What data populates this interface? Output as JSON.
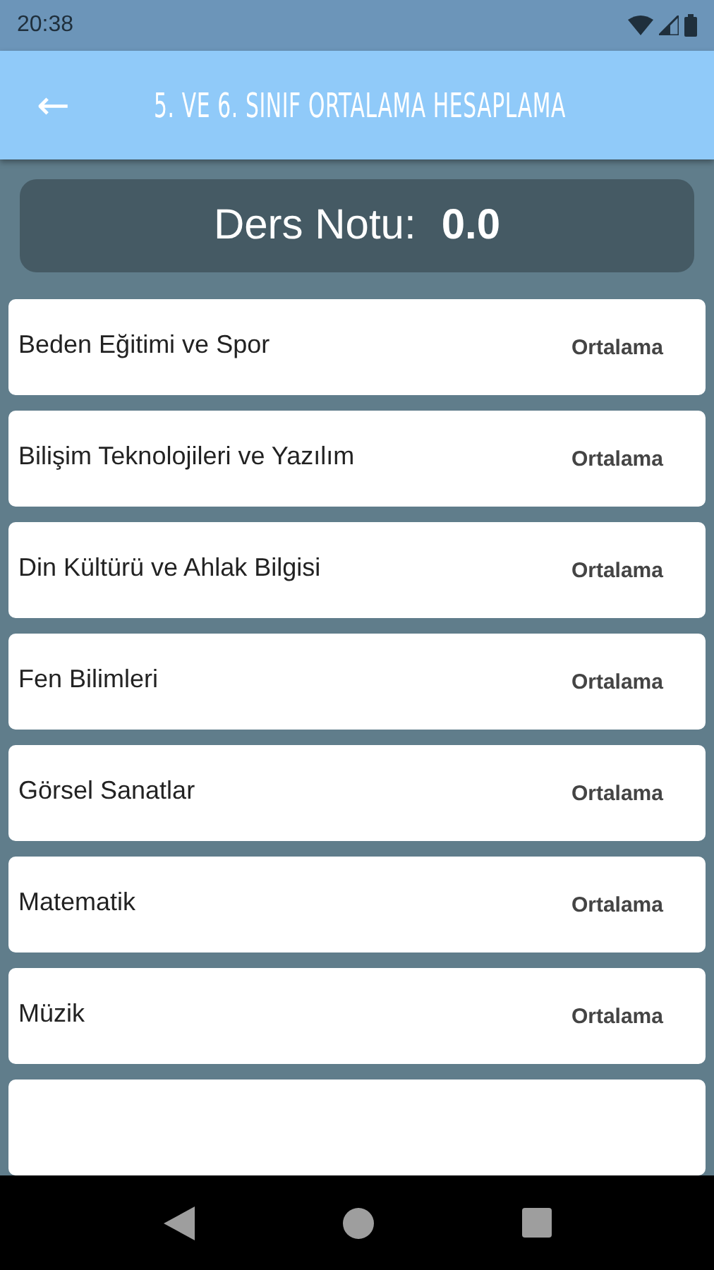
{
  "status_bar": {
    "time": "20:38"
  },
  "app_bar": {
    "back": "←",
    "title": "5. VE 6. SINIF ORTALAMA HESAPLAMA"
  },
  "score_card": {
    "label": "Ders Notu:",
    "value": "0.0"
  },
  "subjects": [
    {
      "name": "Beden Eğitimi ve Spor",
      "action": "Ortalama"
    },
    {
      "name": "Bilişim Teknolojileri ve Yazılım",
      "action": "Ortalama"
    },
    {
      "name": "Din Kültürü ve Ahlak Bilgisi",
      "action": "Ortalama"
    },
    {
      "name": "Fen Bilimleri",
      "action": "Ortalama"
    },
    {
      "name": "Görsel Sanatlar",
      "action": "Ortalama"
    },
    {
      "name": "Matematik",
      "action": "Ortalama"
    },
    {
      "name": "Müzik",
      "action": "Ortalama"
    }
  ]
}
